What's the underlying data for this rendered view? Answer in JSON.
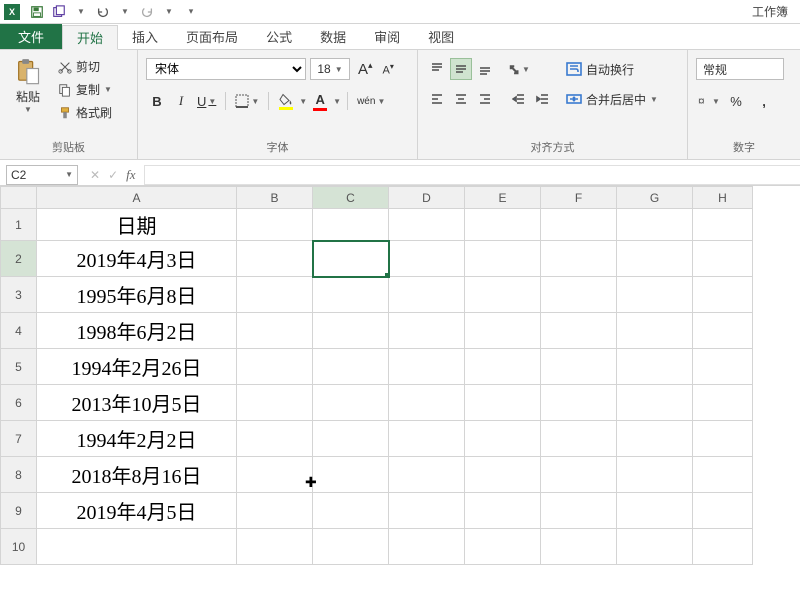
{
  "titlebar": {
    "app": "X",
    "window_title": "工作簿"
  },
  "tabs": {
    "file": "文件",
    "items": [
      "开始",
      "插入",
      "页面布局",
      "公式",
      "数据",
      "审阅",
      "视图"
    ],
    "active_index": 0
  },
  "ribbon": {
    "clipboard": {
      "paste": "粘贴",
      "cut": "剪切",
      "copy": "复制",
      "format_painter": "格式刷",
      "group_label": "剪贴板"
    },
    "font": {
      "name": "宋体",
      "size": "18",
      "bold": "B",
      "italic": "I",
      "underline": "U",
      "wen": "wén",
      "group_label": "字体"
    },
    "align": {
      "wrap": "自动换行",
      "merge": "合并后居中",
      "group_label": "对齐方式"
    },
    "number": {
      "format": "常规",
      "percent": "%",
      "comma": ",",
      "group_label": "数字"
    }
  },
  "formula_bar": {
    "name_box": "C2",
    "fx": "fx"
  },
  "grid": {
    "columns": [
      "A",
      "B",
      "C",
      "D",
      "E",
      "F",
      "G",
      "H"
    ],
    "selected_cell": {
      "col": "C",
      "row": 2
    },
    "rows": [
      {
        "n": 1,
        "A": "日期"
      },
      {
        "n": 2,
        "A": "2019年4月3日"
      },
      {
        "n": 3,
        "A": "1995年6月8日"
      },
      {
        "n": 4,
        "A": "1998年6月2日"
      },
      {
        "n": 5,
        "A": "1994年2月26日"
      },
      {
        "n": 6,
        "A": "2013年10月5日"
      },
      {
        "n": 7,
        "A": "1994年2月2日"
      },
      {
        "n": 8,
        "A": "2018年8月16日"
      },
      {
        "n": 9,
        "A": "2019年4月5日"
      },
      {
        "n": 10,
        "A": ""
      }
    ]
  }
}
